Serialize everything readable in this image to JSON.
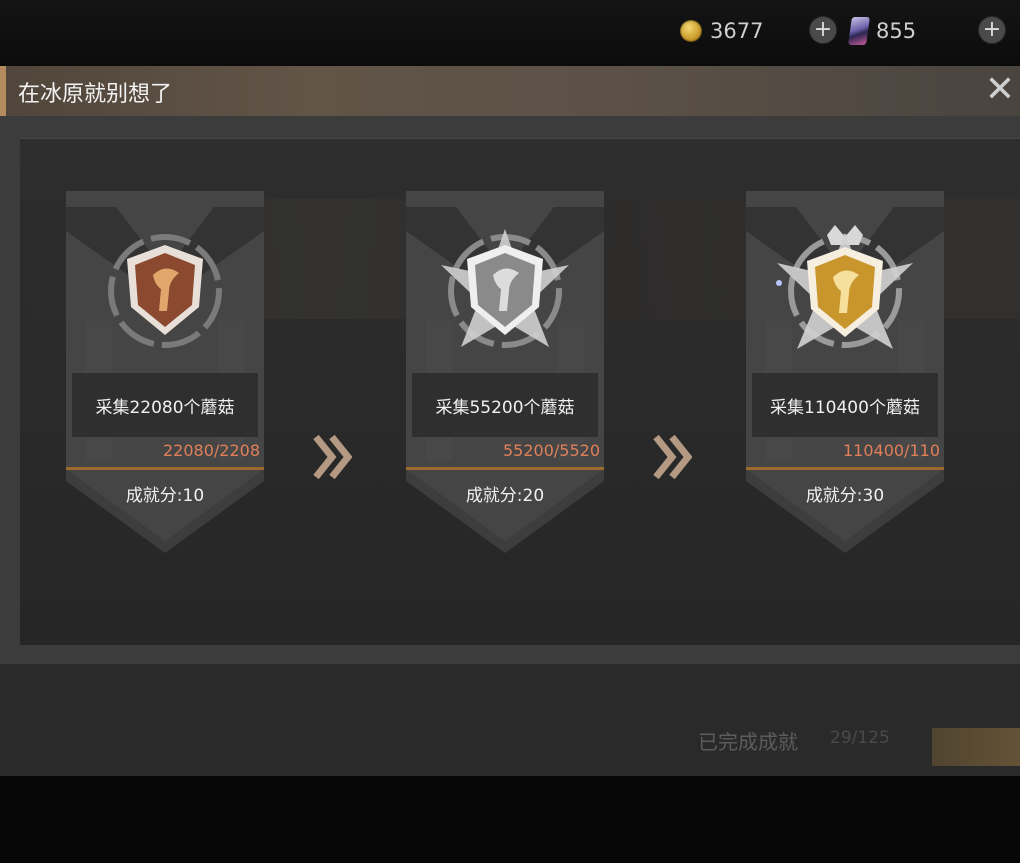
{
  "resources": {
    "gold": {
      "icon": "gold-coin-icon",
      "value": "3677"
    },
    "card": {
      "icon": "card-icon",
      "value": "855"
    }
  },
  "dialog": {
    "title": "在冰原就别想了",
    "close_icon": "close-icon"
  },
  "achievements": [
    {
      "tier": "bronze",
      "task": "采集22080个蘑菇",
      "progress": "22080/2208",
      "score": "成就分:10",
      "color": "#8b4a2f"
    },
    {
      "tier": "silver",
      "task": "采集55200个蘑菇",
      "progress": "55200/5520",
      "score": "成就分:20",
      "color": "#8a8a8a"
    },
    {
      "tier": "gold",
      "task": "采集110400个蘑菇",
      "progress": "110400/110",
      "score": "成就分:30",
      "color": "#c9962e"
    }
  ],
  "footer": {
    "completed_label": "已完成成就",
    "completed_count": "29/125"
  },
  "colors": {
    "accent": "#b58a5c",
    "progress_text": "#e0805a"
  }
}
